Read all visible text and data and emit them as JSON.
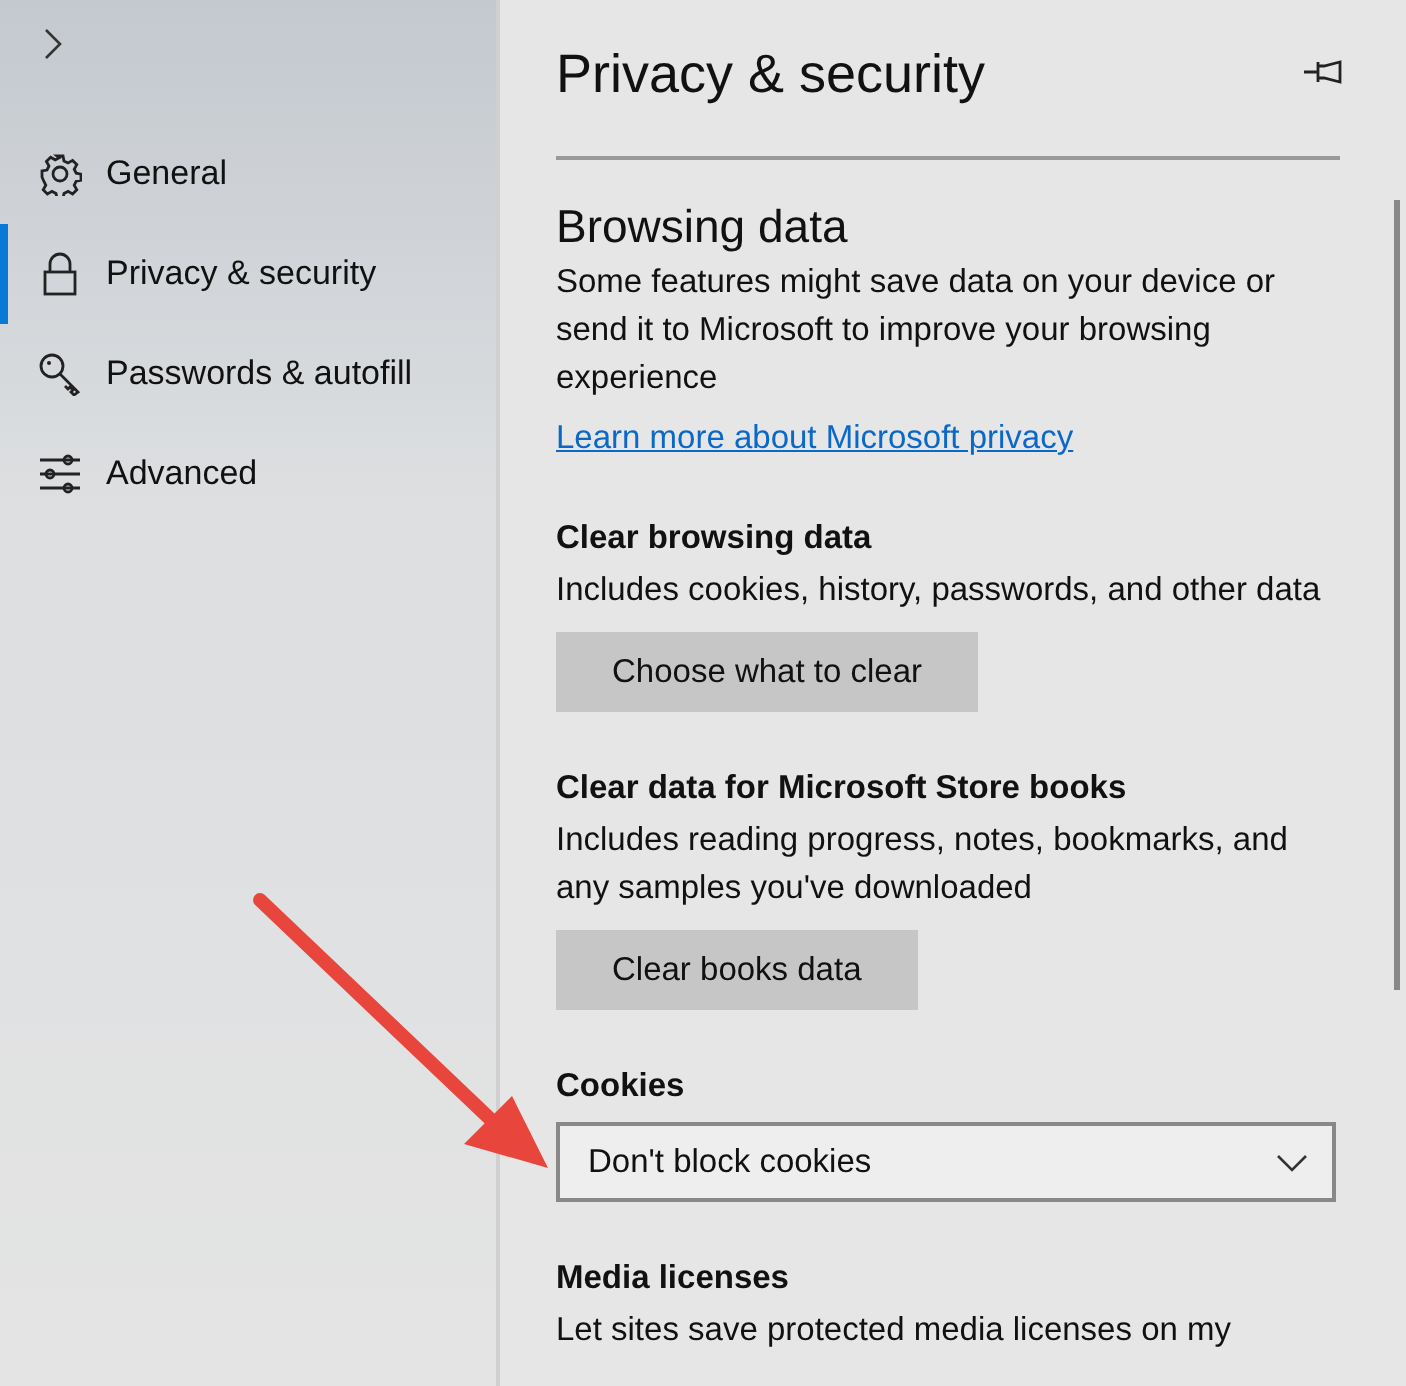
{
  "sidebar": {
    "items": [
      {
        "kind": "gear",
        "label": "General",
        "selected": false
      },
      {
        "kind": "lock",
        "label": "Privacy & security",
        "selected": true
      },
      {
        "kind": "key",
        "label": "Passwords & autofill",
        "selected": false
      },
      {
        "kind": "sliders",
        "label": "Advanced",
        "selected": false
      }
    ]
  },
  "panel": {
    "title": "Privacy & security",
    "heading": "Browsing data",
    "intro": "Some features might save data on your device or send it to Microsoft to improve your browsing experience",
    "link": "Learn more about Microsoft privacy",
    "sections": [
      {
        "kind": "button",
        "title": "Clear browsing data",
        "text": "Includes cookies, history, passwords, and other data",
        "button": "Choose what to clear"
      },
      {
        "kind": "button",
        "title": "Clear data for Microsoft Store books",
        "text": "Includes reading progress, notes, bookmarks, and any samples you've downloaded",
        "button": "Clear books data"
      },
      {
        "kind": "dropdown",
        "title": "Cookies",
        "value": "Don't block cookies"
      },
      {
        "kind": "text",
        "title": "Media licenses",
        "text": "Let sites save protected media licenses on my"
      }
    ]
  }
}
